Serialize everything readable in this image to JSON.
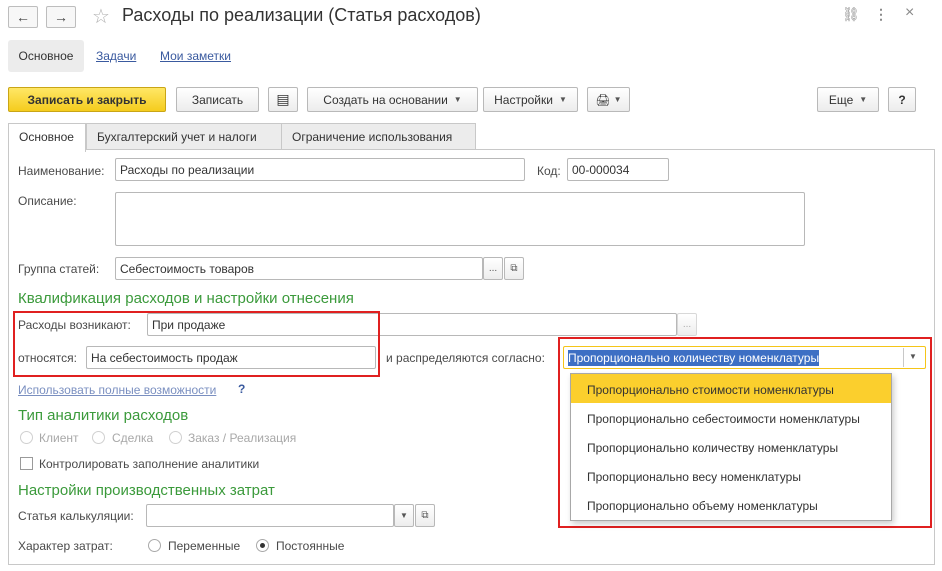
{
  "window": {
    "title": "Расходы по реализации (Статья расходов)",
    "back_icon": "←",
    "forward_icon": "→",
    "star_icon": "☆",
    "link_icon": "⛓",
    "menu_icon": "⋮",
    "maximize_icon": "□",
    "close_icon": "×"
  },
  "top_tabs": {
    "main": "Основное",
    "tasks": "Задачи",
    "notes": "Мои заметки"
  },
  "toolbar": {
    "save_close": "Записать и закрыть",
    "save": "Записать",
    "list_icon": "▤",
    "create_based": "Создать на основании",
    "settings": "Настройки",
    "print_icon": "🖨",
    "more": "Еще",
    "help": "?"
  },
  "form_tabs": {
    "main": "Основное",
    "accounting": "Бухгалтерский учет и налоги",
    "restrictions": "Ограничение использования"
  },
  "form": {
    "name_label": "Наименование:",
    "name_value": "Расходы по реализации",
    "code_label": "Код:",
    "code_value": "00-000034",
    "description_label": "Описание:",
    "description_value": "",
    "group_label": "Группа статей:",
    "group_value": "Себестоимость товаров",
    "ellipsis": "...",
    "open": "⧉",
    "section_qualification": "Квалификация расходов и настройки отнесения",
    "arise_label": "Расходы возникают:",
    "arise_value": "При продаже",
    "relate_label": "относятся:",
    "relate_value": "На себестоимость продаж",
    "distribute_label": "и распределяются согласно:",
    "distribute_value": "Пропорционально количеству номенклатуры",
    "full_features_link": "Использовать полные возможности",
    "help_q": "?",
    "section_analytics": "Тип аналитики расходов",
    "radio_client": "Клиент",
    "radio_deal": "Сделка",
    "radio_order": "Заказ / Реализация",
    "check_analytics": "Контролировать заполнение аналитики",
    "section_production": "Настройки производственных затрат",
    "calc_item_label": "Статья калькуляции:",
    "calc_item_value": "",
    "cost_nature_label": "Характер затрат:",
    "radio_variable": "Переменные",
    "radio_fixed": "Постоянные"
  },
  "dropdown_options": [
    "Пропорционально стоимости номенклатуры",
    "Пропорционально себестоимости номенклатуры",
    "Пропорционально количеству номенклатуры",
    "Пропорционально весу номенклатуры",
    "Пропорционально объему номенклатуры"
  ],
  "colors": {
    "accent_yellow": "#fbcf2d",
    "section_green": "#3b9a3b",
    "highlight_red": "#e02020",
    "selection_blue": "#3d6fc4"
  }
}
